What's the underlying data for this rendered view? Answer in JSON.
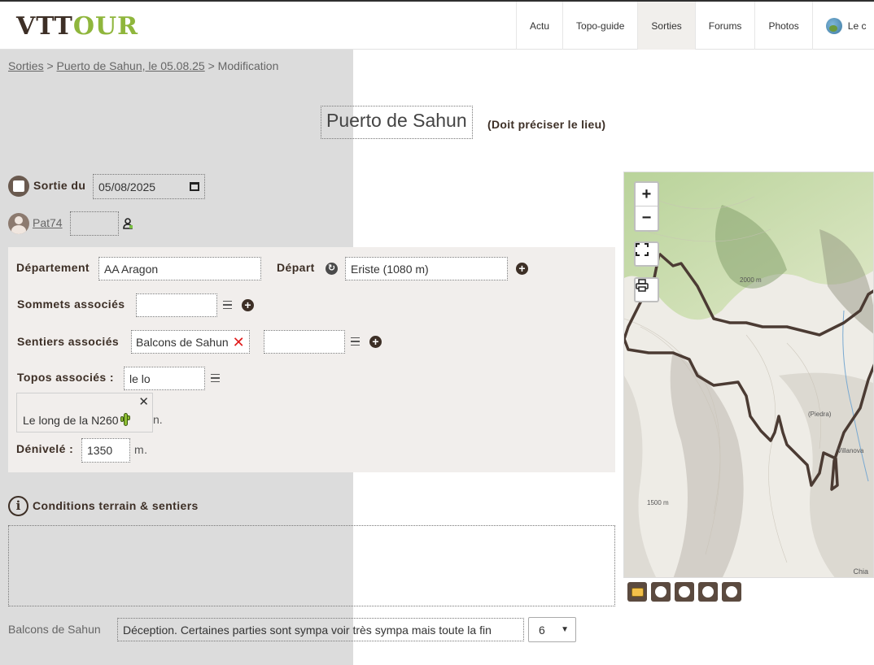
{
  "nav": {
    "logo_part1": "VTT",
    "logo_part2": "OUR",
    "links": [
      "Actu",
      "Topo-guide",
      "Sorties",
      "Forums",
      "Photos"
    ],
    "active": "Sorties",
    "user_label": "Le c"
  },
  "breadcrumb": {
    "root": "Sorties",
    "sep": ">",
    "trip": "Puerto de Sahun, le 05.08.25",
    "current": "Modification"
  },
  "title": {
    "value": "Puerto de Sahun",
    "note": "(Doit préciser le lieu)"
  },
  "form": {
    "sortie_label": "Sortie du",
    "date_value": "05/08/2025",
    "author": "Pat74",
    "departement_label": "Département",
    "departement_value": "AA Aragon",
    "depart_label": "Départ",
    "depart_value": "Eriste (1080 m)",
    "sommets_label": "Sommets associés",
    "sentiers_label": "Sentiers associés",
    "sentier_chip": "Balcons de Sahun",
    "topos_label": "Topos associés :",
    "topos_value": "le lo",
    "suggestion": "Le long de la N260",
    "suggestion_hidden_unit": "n.",
    "denivele_label": "Dénivelé :",
    "denivele_value": "1350",
    "unit_m": "m."
  },
  "conditions": {
    "title": "Conditions terrain & sentiers",
    "text": ""
  },
  "trail_review": {
    "label": "Balcons de Sahun",
    "comment": "Déception. Certaines parties sont sympa voir très sympa mais toute la fin",
    "rating": "6"
  },
  "map": {
    "zoom_in": "+",
    "zoom_out": "−",
    "attribution": "Chia",
    "places": [
      "Villanova",
      "(Piedra)",
      "2000 m",
      "1500 m"
    ]
  }
}
